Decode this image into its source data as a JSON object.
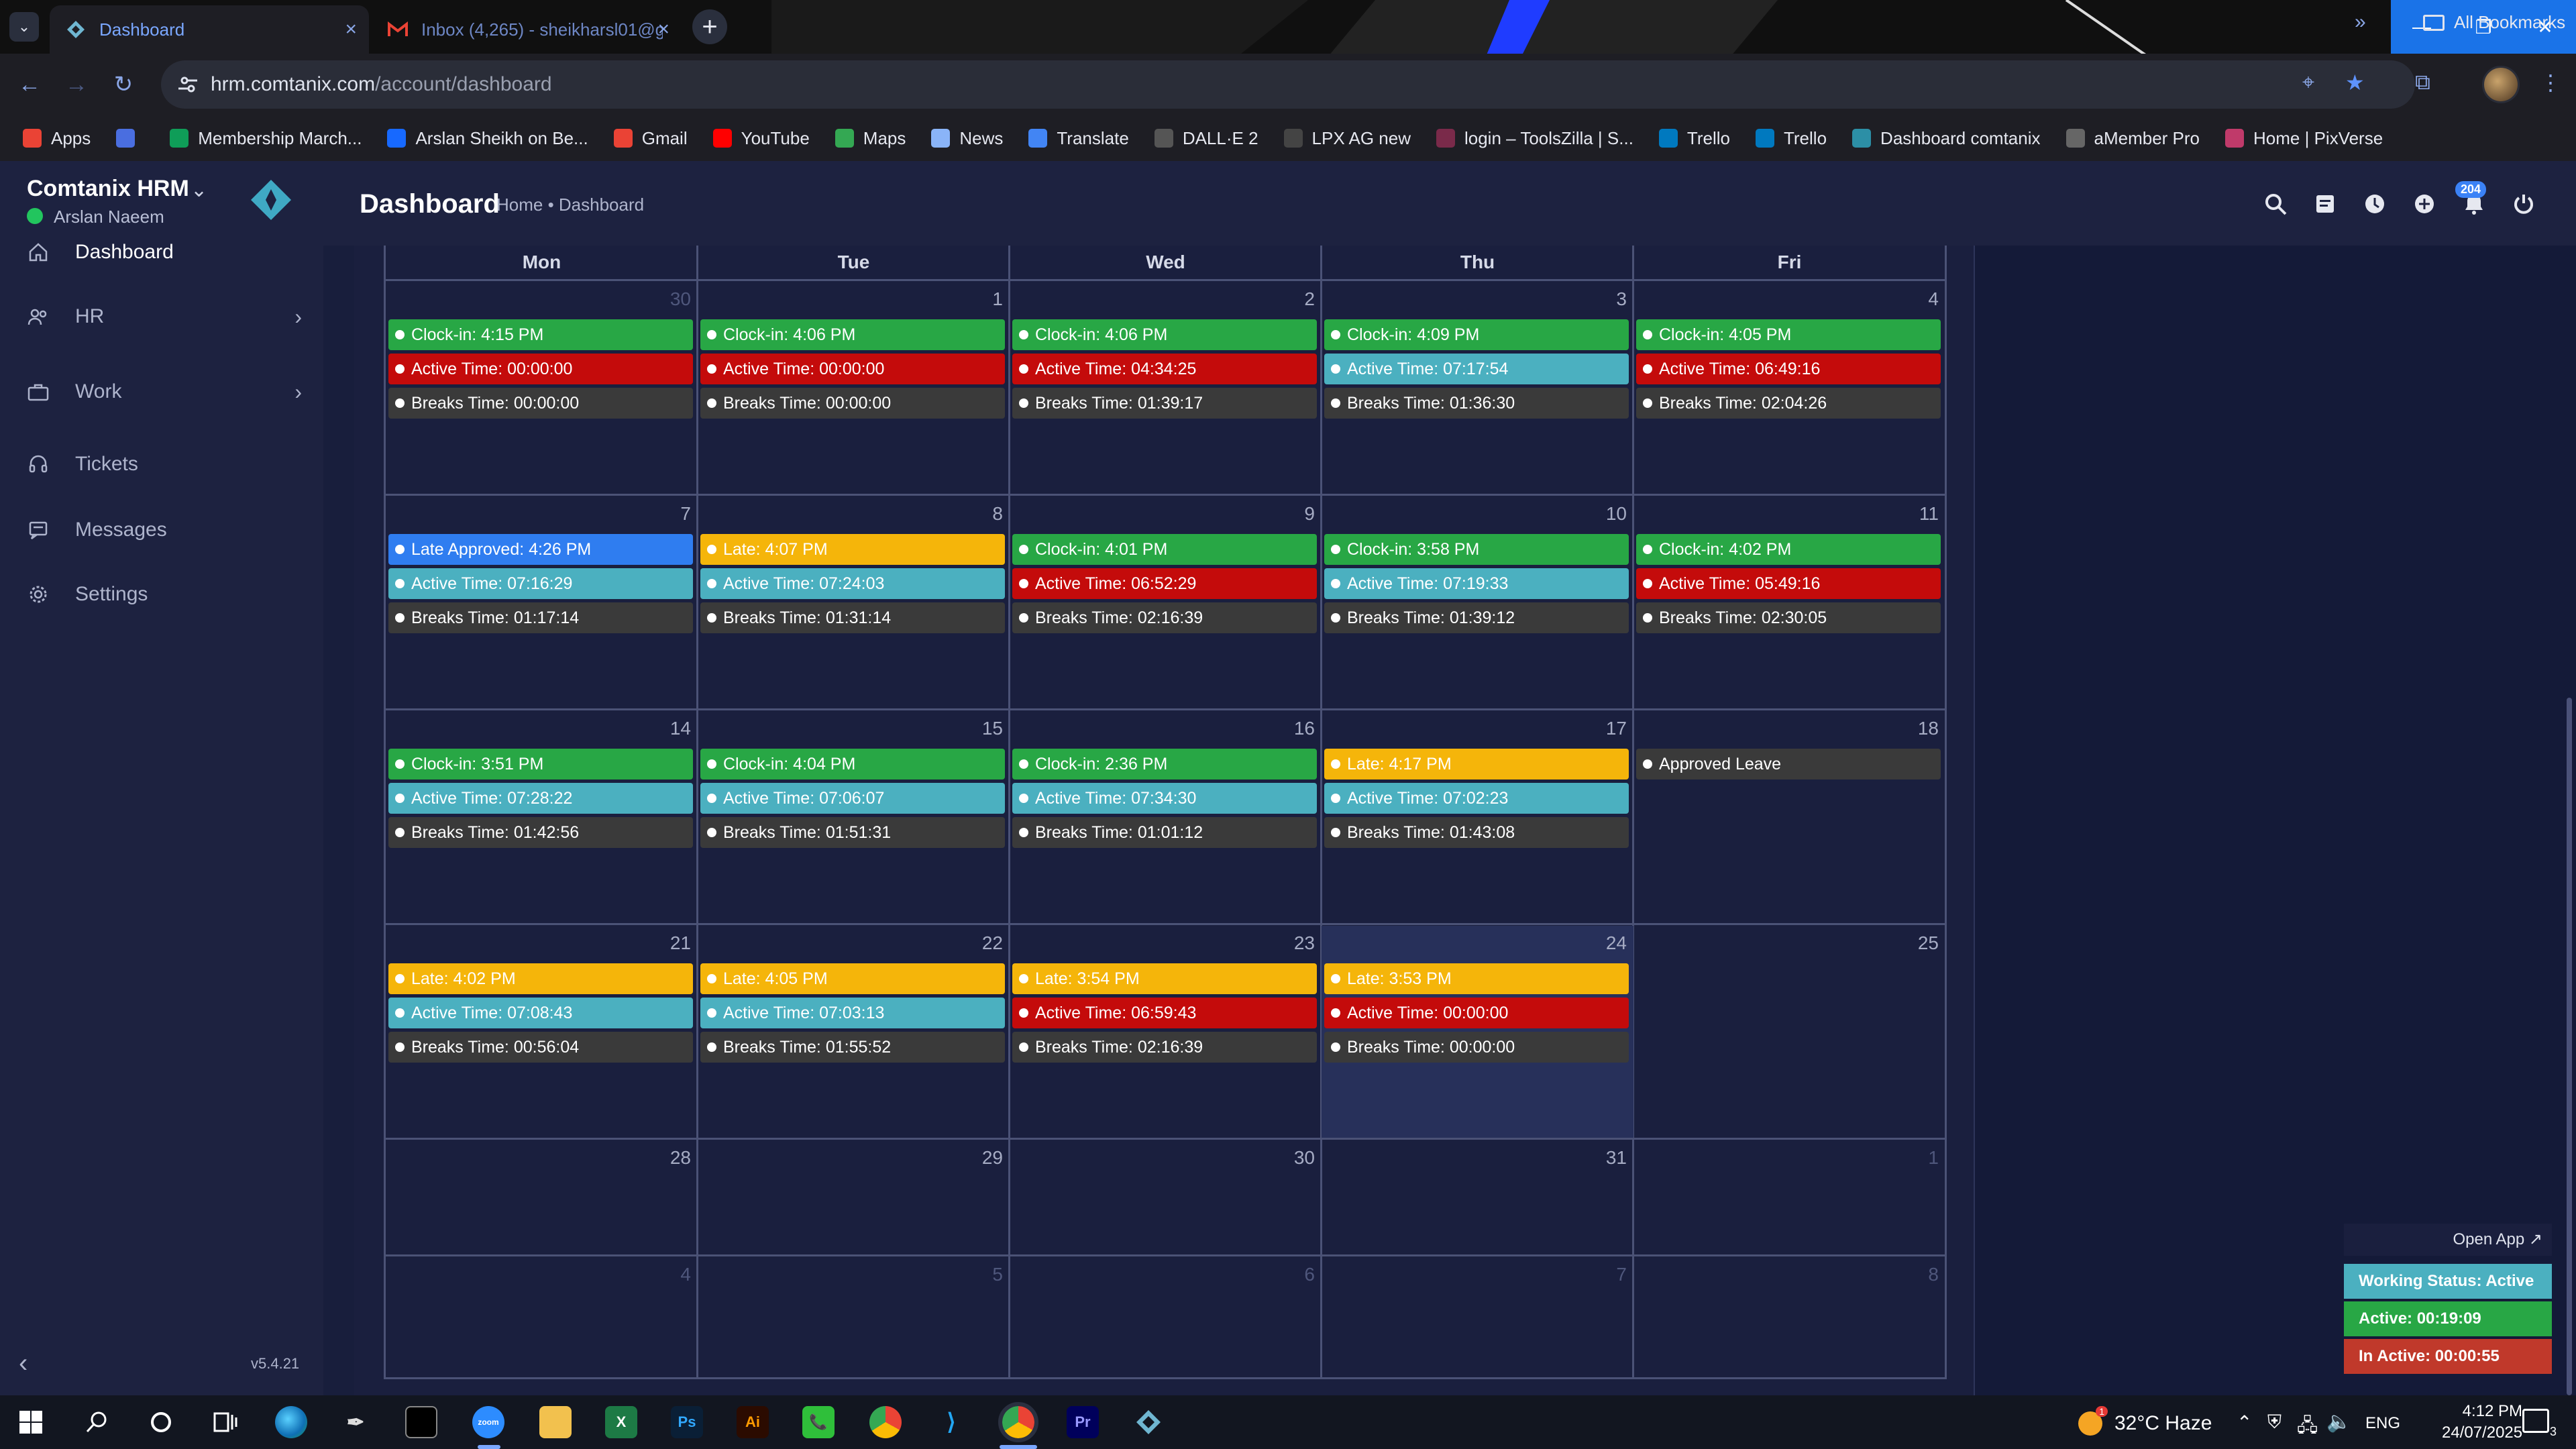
{
  "browser": {
    "tabs": [
      {
        "title": "Dashboard",
        "active": true
      },
      {
        "title": "Inbox (4,265) - sheikharsl01@g",
        "active": false
      }
    ],
    "url_domain": "hrm.comtanix.com",
    "url_path": "/account/dashboard",
    "bookmarks": [
      {
        "label": "Apps",
        "icon": "apps-grid-icon",
        "color": "#ea4335"
      },
      {
        "label": "",
        "icon": "grid-icon",
        "color": "#4a6ee0"
      },
      {
        "label": "Membership March...",
        "icon": "membership-icon",
        "color": "#0f9d58"
      },
      {
        "label": "Arslan Sheikh on Be...",
        "icon": "behance-icon",
        "color": "#1769ff"
      },
      {
        "label": "Gmail",
        "icon": "gmail-icon",
        "color": "#ea4335"
      },
      {
        "label": "YouTube",
        "icon": "youtube-icon",
        "color": "#ff0000"
      },
      {
        "label": "Maps",
        "icon": "maps-icon",
        "color": "#34a853"
      },
      {
        "label": "News",
        "icon": "news-icon",
        "color": "#8ab4f8"
      },
      {
        "label": "Translate",
        "icon": "translate-icon",
        "color": "#4285f4"
      },
      {
        "label": "DALL·E 2",
        "icon": "openai-icon",
        "color": "#555555"
      },
      {
        "label": "LPX AG new",
        "icon": "dash-icon",
        "color": "#444444"
      },
      {
        "label": "login – ToolsZilla | S...",
        "icon": "toolszilla-icon",
        "color": "#7a2a4a"
      },
      {
        "label": "Trello",
        "icon": "trello-icon",
        "color": "#0079bf"
      },
      {
        "label": "Trello",
        "icon": "trello-icon",
        "color": "#0079bf"
      },
      {
        "label": "Dashboard comtanix",
        "icon": "comtanix-icon",
        "color": "#2c8fa6"
      },
      {
        "label": "aMember Pro",
        "icon": "amember-icon",
        "color": "#666666"
      },
      {
        "label": "Home | PixVerse",
        "icon": "pixverse-icon",
        "color": "#c03a6a"
      }
    ],
    "all_bookmarks": "All Bookmarks"
  },
  "app": {
    "brand": "Comtanix HRM",
    "user": "Arslan Naeem",
    "nav": [
      {
        "label": "Dashboard",
        "icon": "home-icon",
        "arrow": false
      },
      {
        "label": "HR",
        "icon": "users-icon",
        "arrow": true
      },
      {
        "label": "Work",
        "icon": "briefcase-icon",
        "arrow": true
      },
      {
        "label": "Tickets",
        "icon": "headset-icon",
        "arrow": false
      },
      {
        "label": "Messages",
        "icon": "message-icon",
        "arrow": false
      },
      {
        "label": "Settings",
        "icon": "gear-icon",
        "arrow": false
      }
    ],
    "version": "v5.4.21",
    "page_title": "Dashboard",
    "breadcrumb": "Home • Dashboard",
    "notification_count": "204",
    "colors": {
      "clockin": "#28a745",
      "active_red": "#c40b0b",
      "active_teal": "#4bb0c0",
      "breaks": "#3a3a3a",
      "late": "#f5b50a",
      "late_approved": "#2f7df0",
      "leave": "#3a3a3a"
    }
  },
  "calendar": {
    "weekdays": [
      "Mon",
      "Tue",
      "Wed",
      "Thu",
      "Fri"
    ],
    "weeks": [
      [
        {
          "day": "30",
          "muted": true,
          "events": [
            {
              "t": "clockin",
              "text": "Clock-in: 4:15 PM"
            },
            {
              "t": "active_red",
              "text": "Active Time: 00:00:00"
            },
            {
              "t": "breaks",
              "text": "Breaks Time: 00:00:00"
            }
          ]
        },
        {
          "day": "1",
          "events": [
            {
              "t": "clockin",
              "text": "Clock-in: 4:06 PM"
            },
            {
              "t": "active_red",
              "text": "Active Time: 00:00:00"
            },
            {
              "t": "breaks",
              "text": "Breaks Time: 00:00:00"
            }
          ]
        },
        {
          "day": "2",
          "events": [
            {
              "t": "clockin",
              "text": "Clock-in: 4:06 PM"
            },
            {
              "t": "active_red",
              "text": "Active Time: 04:34:25"
            },
            {
              "t": "breaks",
              "text": "Breaks Time: 01:39:17"
            }
          ]
        },
        {
          "day": "3",
          "events": [
            {
              "t": "clockin",
              "text": "Clock-in: 4:09 PM"
            },
            {
              "t": "active_teal",
              "text": "Active Time: 07:17:54"
            },
            {
              "t": "breaks",
              "text": "Breaks Time: 01:36:30"
            }
          ]
        },
        {
          "day": "4",
          "events": [
            {
              "t": "clockin",
              "text": "Clock-in: 4:05 PM"
            },
            {
              "t": "active_red",
              "text": "Active Time: 06:49:16"
            },
            {
              "t": "breaks",
              "text": "Breaks Time: 02:04:26"
            }
          ]
        }
      ],
      [
        {
          "day": "7",
          "events": [
            {
              "t": "late_approved",
              "text": "Late Approved: 4:26 PM"
            },
            {
              "t": "active_teal",
              "text": "Active Time: 07:16:29"
            },
            {
              "t": "breaks",
              "text": "Breaks Time: 01:17:14"
            }
          ]
        },
        {
          "day": "8",
          "events": [
            {
              "t": "late",
              "text": "Late: 4:07 PM"
            },
            {
              "t": "active_teal",
              "text": "Active Time: 07:24:03"
            },
            {
              "t": "breaks",
              "text": "Breaks Time: 01:31:14"
            }
          ]
        },
        {
          "day": "9",
          "events": [
            {
              "t": "clockin",
              "text": "Clock-in: 4:01 PM"
            },
            {
              "t": "active_red",
              "text": "Active Time: 06:52:29"
            },
            {
              "t": "breaks",
              "text": "Breaks Time: 02:16:39"
            }
          ]
        },
        {
          "day": "10",
          "events": [
            {
              "t": "clockin",
              "text": "Clock-in: 3:58 PM"
            },
            {
              "t": "active_teal",
              "text": "Active Time: 07:19:33"
            },
            {
              "t": "breaks",
              "text": "Breaks Time: 01:39:12"
            }
          ]
        },
        {
          "day": "11",
          "events": [
            {
              "t": "clockin",
              "text": "Clock-in: 4:02 PM"
            },
            {
              "t": "active_red",
              "text": "Active Time: 05:49:16"
            },
            {
              "t": "breaks",
              "text": "Breaks Time: 02:30:05"
            }
          ]
        }
      ],
      [
        {
          "day": "14",
          "events": [
            {
              "t": "clockin",
              "text": "Clock-in: 3:51 PM"
            },
            {
              "t": "active_teal",
              "text": "Active Time: 07:28:22"
            },
            {
              "t": "breaks",
              "text": "Breaks Time: 01:42:56"
            }
          ]
        },
        {
          "day": "15",
          "events": [
            {
              "t": "clockin",
              "text": "Clock-in: 4:04 PM"
            },
            {
              "t": "active_teal",
              "text": "Active Time: 07:06:07"
            },
            {
              "t": "breaks",
              "text": "Breaks Time: 01:51:31"
            }
          ]
        },
        {
          "day": "16",
          "events": [
            {
              "t": "clockin",
              "text": "Clock-in: 2:36 PM"
            },
            {
              "t": "active_teal",
              "text": "Active Time: 07:34:30"
            },
            {
              "t": "breaks",
              "text": "Breaks Time: 01:01:12"
            }
          ]
        },
        {
          "day": "17",
          "events": [
            {
              "t": "late",
              "text": "Late: 4:17 PM"
            },
            {
              "t": "active_teal",
              "text": "Active Time: 07:02:23"
            },
            {
              "t": "breaks",
              "text": "Breaks Time: 01:43:08"
            }
          ]
        },
        {
          "day": "18",
          "events": [
            {
              "t": "leave",
              "text": "Approved Leave"
            }
          ]
        }
      ],
      [
        {
          "day": "21",
          "events": [
            {
              "t": "late",
              "text": "Late: 4:02 PM"
            },
            {
              "t": "active_teal",
              "text": "Active Time: 07:08:43"
            },
            {
              "t": "breaks",
              "text": "Breaks Time: 00:56:04"
            }
          ]
        },
        {
          "day": "22",
          "events": [
            {
              "t": "late",
              "text": "Late: 4:05 PM"
            },
            {
              "t": "active_teal",
              "text": "Active Time: 07:03:13"
            },
            {
              "t": "breaks",
              "text": "Breaks Time: 01:55:52"
            }
          ]
        },
        {
          "day": "23",
          "events": [
            {
              "t": "late",
              "text": "Late: 3:54 PM"
            },
            {
              "t": "active_red",
              "text": "Active Time: 06:59:43"
            },
            {
              "t": "breaks",
              "text": "Breaks Time: 02:16:39"
            }
          ]
        },
        {
          "day": "24",
          "today": true,
          "events": [
            {
              "t": "late",
              "text": "Late: 3:53 PM"
            },
            {
              "t": "active_red",
              "text": "Active Time: 00:00:00"
            },
            {
              "t": "breaks",
              "text": "Breaks Time: 00:00:00"
            }
          ]
        },
        {
          "day": "25",
          "events": []
        }
      ],
      [
        {
          "day": "28",
          "events": []
        },
        {
          "day": "29",
          "events": []
        },
        {
          "day": "30",
          "events": []
        },
        {
          "day": "31",
          "events": []
        },
        {
          "day": "1",
          "muted": true,
          "events": []
        }
      ],
      [
        {
          "day": "4",
          "muted": true,
          "events": []
        },
        {
          "day": "5",
          "muted": true,
          "events": []
        },
        {
          "day": "6",
          "muted": true,
          "events": []
        },
        {
          "day": "7",
          "muted": true,
          "events": []
        },
        {
          "day": "8",
          "muted": true,
          "events": []
        }
      ]
    ]
  },
  "work_widget": {
    "open_app": "Open App ↗",
    "working_status": "Working Status: Active",
    "active": "Active: 00:19:09",
    "inactive": "In Active: 00:00:55",
    "colors": {
      "status": "#4bb0c0",
      "active": "#28a745",
      "inactive": "#c0392b"
    }
  },
  "taskbar": {
    "weather": "32°C Haze",
    "weather_badge": "1",
    "lang": "ENG",
    "time": "4:12 PM",
    "date": "24/07/2025",
    "notifications": "3"
  }
}
